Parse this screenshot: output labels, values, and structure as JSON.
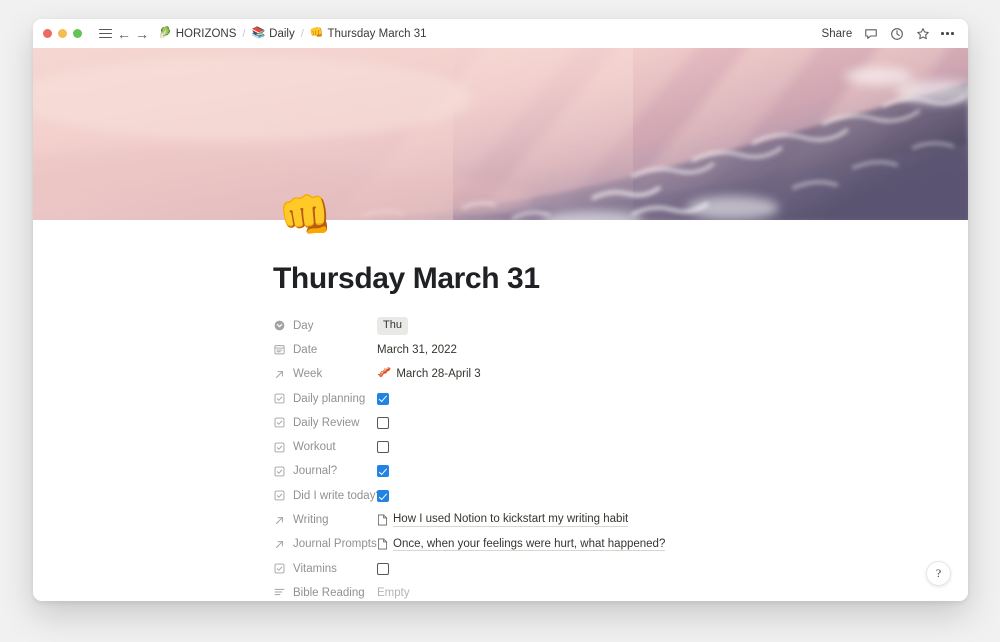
{
  "window": {
    "traffic_lights": [
      "close",
      "minimize",
      "maximize"
    ],
    "menu_icon": "hamburger-icon",
    "back_icon": "back-arrow-icon",
    "forward_icon": "forward-arrow-icon"
  },
  "breadcrumb": {
    "items": [
      {
        "emoji": "🥬",
        "label": "HORIZONS"
      },
      {
        "emoji": "📚",
        "label": "Daily"
      },
      {
        "emoji": "👊",
        "label": "Thursday March 31"
      }
    ],
    "separator": "/"
  },
  "toolbar": {
    "share_label": "Share",
    "comment_icon": "comment-icon",
    "history_icon": "clock-history-icon",
    "favorite_icon": "star-icon",
    "more_icon": "more-options-icon"
  },
  "cover": {
    "description": "aerial photograph of snow covered mountains under pink light",
    "colors": {
      "top_left": "#f2cfcd",
      "mid": "#e7b9bd",
      "right_dark": "#7d7191",
      "highlight": "#f7dedc"
    }
  },
  "page": {
    "emoji": "👊",
    "title": "Thursday March 31"
  },
  "properties": [
    {
      "icon": "select-icon",
      "label": "Day",
      "type": "select",
      "value": "Thu"
    },
    {
      "icon": "calendar-icon",
      "label": "Date",
      "type": "date",
      "value": "March 31, 2022"
    },
    {
      "icon": "relation-icon",
      "label": "Week",
      "type": "relation",
      "emoji": "🥓",
      "value": "March 28-April 3"
    },
    {
      "icon": "checkbox-icon",
      "label": "Daily planning",
      "type": "checkbox",
      "checked": true
    },
    {
      "icon": "checkbox-icon",
      "label": "Daily Review",
      "type": "checkbox",
      "checked": false
    },
    {
      "icon": "checkbox-icon",
      "label": "Workout",
      "type": "checkbox",
      "checked": false
    },
    {
      "icon": "checkbox-icon",
      "label": "Journal?",
      "type": "checkbox",
      "checked": true
    },
    {
      "icon": "checkbox-icon",
      "label": "Did I write today?",
      "type": "checkbox",
      "checked": true
    },
    {
      "icon": "relation-icon",
      "label": "Writing",
      "type": "page-link",
      "value": "How I used Notion to kickstart my writing habit"
    },
    {
      "icon": "relation-icon",
      "label": "Journal Prompts",
      "type": "page-link",
      "value": "Once, when your feelings were hurt, what happened?"
    },
    {
      "icon": "checkbox-icon",
      "label": "Vitamins",
      "type": "checkbox",
      "checked": false
    },
    {
      "icon": "text-icon",
      "label": "Bible Reading",
      "type": "text",
      "value": "Empty"
    }
  ],
  "help": {
    "label": "?"
  },
  "colors": {
    "accent_blue": "#2383e2",
    "tag_gray": "#e9e9e7",
    "text": "#37352f",
    "muted": "#91918e",
    "desktop": "#f1f1f1"
  }
}
